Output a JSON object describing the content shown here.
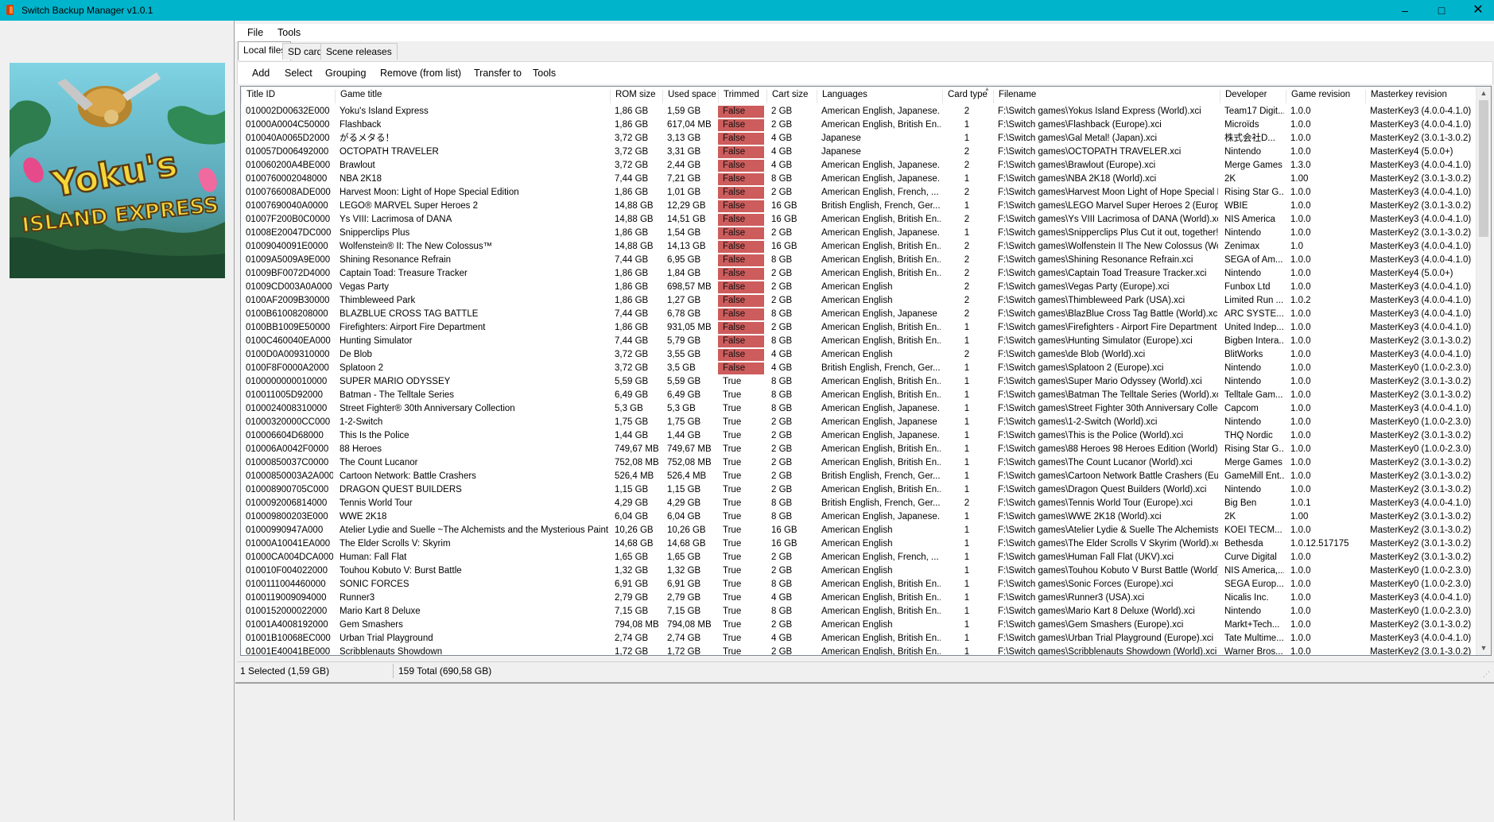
{
  "window": {
    "title": "Switch Backup Manager v1.0.1"
  },
  "menu": {
    "file": "File",
    "tools": "Tools"
  },
  "tabs": [
    "Local files",
    "SD card",
    "Scene releases"
  ],
  "toolbar": [
    "Add",
    "Select",
    "Grouping",
    "Remove (from list)",
    "Transfer to",
    "Tools"
  ],
  "cover": {
    "caption": "Yoku's Island Express"
  },
  "columns": [
    "Title ID",
    "Game title",
    "ROM size",
    "Used space",
    "Trimmed",
    "Cart size",
    "Languages",
    "Card type",
    "Filename",
    "Developer",
    "Game revision",
    "Masterkey revision"
  ],
  "rows": [
    [
      "010002D00632E000",
      "Yoku's Island Express",
      "1,86 GB",
      "1,59 GB",
      "False",
      "2 GB",
      "American English, Japanese...",
      "2",
      "F:\\Switch games\\Yokus Island Express (World).xci",
      "Team17 Digit...",
      "1.0.0",
      "MasterKey3 (4.0.0-4.1.0)"
    ],
    [
      "01000A0004C50000",
      "Flashback",
      "1,86 GB",
      "617,04 MB",
      "False",
      "2 GB",
      "American English, British En...",
      "1",
      "F:\\Switch games\\Flashback (Europe).xci",
      "Microïds",
      "1.0.0",
      "MasterKey3 (4.0.0-4.1.0)"
    ],
    [
      "010040A0065D2000",
      "がるメタる！",
      "3,72 GB",
      "3,13 GB",
      "False",
      "4 GB",
      "Japanese",
      "1",
      "F:\\Switch games\\Gal Metal! (Japan).xci",
      "株式会社D...",
      "1.0.0",
      "MasterKey2 (3.0.1-3.0.2)"
    ],
    [
      "010057D006492000",
      "OCTOPATH TRAVELER",
      "3,72 GB",
      "3,31 GB",
      "False",
      "4 GB",
      "Japanese",
      "2",
      "F:\\Switch games\\OCTOPATH TRAVELER.xci",
      "Nintendo",
      "1.0.0",
      "MasterKey4 (5.0.0+)"
    ],
    [
      "010060200A4BE000",
      "Brawlout",
      "3,72 GB",
      "2,44 GB",
      "False",
      "4 GB",
      "American English, Japanese...",
      "2",
      "F:\\Switch games\\Brawlout (Europe).xci",
      "Merge Games",
      "1.3.0",
      "MasterKey3 (4.0.0-4.1.0)"
    ],
    [
      "0100760002048000",
      "NBA 2K18",
      "7,44 GB",
      "7,21 GB",
      "False",
      "8 GB",
      "American English, Japanese...",
      "1",
      "F:\\Switch games\\NBA 2K18 (World).xci",
      "2K",
      "1.00",
      "MasterKey2 (3.0.1-3.0.2)"
    ],
    [
      "0100766008ADE000",
      "Harvest Moon: Light of Hope Special Edition",
      "1,86 GB",
      "1,01 GB",
      "False",
      "2 GB",
      "American English, French, ...",
      "2",
      "F:\\Switch games\\Harvest Moon Light of Hope Special E...",
      "Rising Star G...",
      "1.0.0",
      "MasterKey3 (4.0.0-4.1.0)"
    ],
    [
      "01007690040A0000",
      "LEGO® MARVEL Super Heroes 2",
      "14,88 GB",
      "12,29 GB",
      "False",
      "16 GB",
      "British English, French, Ger...",
      "1",
      "F:\\Switch games\\LEGO Marvel Super Heroes 2 (Europe...",
      "WBIE",
      "1.0.0",
      "MasterKey2 (3.0.1-3.0.2)"
    ],
    [
      "01007F200B0C0000",
      "Ys VIII: Lacrimosa of DANA",
      "14,88 GB",
      "14,51 GB",
      "False",
      "16 GB",
      "American English, British En...",
      "2",
      "F:\\Switch games\\Ys VIII Lacrimosa of DANA (World).xci",
      "NIS America",
      "1.0.0",
      "MasterKey3 (4.0.0-4.1.0)"
    ],
    [
      "01008E20047DC000",
      "Snipperclips Plus",
      "1,86 GB",
      "1,54 GB",
      "False",
      "2 GB",
      "American English, Japanese...",
      "1",
      "F:\\Switch games\\Snipperclips Plus Cut it out, together! (...",
      "Nintendo",
      "1.0.0",
      "MasterKey2 (3.0.1-3.0.2)"
    ],
    [
      "01009040091E0000",
      "Wolfenstein® II: The New Colossus™",
      "14,88 GB",
      "14,13 GB",
      "False",
      "16 GB",
      "American English, British En...",
      "2",
      "F:\\Switch games\\Wolfenstein II The New Colossus (Wo...",
      "Zenimax",
      "1.0",
      "MasterKey3 (4.0.0-4.1.0)"
    ],
    [
      "01009A5009A9E000",
      "Shining Resonance Refrain",
      "7,44 GB",
      "6,95 GB",
      "False",
      "8 GB",
      "American English, British En...",
      "2",
      "F:\\Switch games\\Shining Resonance Refrain.xci",
      "SEGA of Am...",
      "1.0.0",
      "MasterKey3 (4.0.0-4.1.0)"
    ],
    [
      "01009BF0072D4000",
      "Captain Toad: Treasure Tracker",
      "1,86 GB",
      "1,84 GB",
      "False",
      "2 GB",
      "American English, British En...",
      "2",
      "F:\\Switch games\\Captain Toad Treasure Tracker.xci",
      "Nintendo",
      "1.0.0",
      "MasterKey4 (5.0.0+)"
    ],
    [
      "01009CD003A0A000",
      "Vegas Party",
      "1,86 GB",
      "698,57 MB",
      "False",
      "2 GB",
      "American English",
      "2",
      "F:\\Switch games\\Vegas Party (Europe).xci",
      "Funbox Ltd",
      "1.0.0",
      "MasterKey3 (4.0.0-4.1.0)"
    ],
    [
      "0100AF2009B30000",
      "Thimbleweed Park",
      "1,86 GB",
      "1,27 GB",
      "False",
      "2 GB",
      "American English",
      "2",
      "F:\\Switch games\\Thimbleweed Park (USA).xci",
      "Limited Run ...",
      "1.0.2",
      "MasterKey3 (4.0.0-4.1.0)"
    ],
    [
      "0100B61008208000",
      "BLAZBLUE CROSS TAG BATTLE",
      "7,44 GB",
      "6,78 GB",
      "False",
      "8 GB",
      "American English, Japanese",
      "2",
      "F:\\Switch games\\BlazBlue Cross Tag Battle (World).xci",
      "ARC SYSTE...",
      "1.0.0",
      "MasterKey3 (4.0.0-4.1.0)"
    ],
    [
      "0100BB1009E50000",
      "Firefighters: Airport Fire Department",
      "1,86 GB",
      "931,05 MB",
      "False",
      "2 GB",
      "American English, British En...",
      "1",
      "F:\\Switch games\\Firefighters - Airport Fire Department (E...",
      "United Indep...",
      "1.0.0",
      "MasterKey3 (4.0.0-4.1.0)"
    ],
    [
      "0100C460040EA000",
      "Hunting Simulator",
      "7,44 GB",
      "5,79 GB",
      "False",
      "8 GB",
      "American English, British En...",
      "1",
      "F:\\Switch games\\Hunting Simulator (Europe).xci",
      "Bigben Intera...",
      "1.0.0",
      "MasterKey2 (3.0.1-3.0.2)"
    ],
    [
      "0100D0A009310000",
      "De Blob",
      "3,72 GB",
      "3,55 GB",
      "False",
      "4 GB",
      "American English",
      "2",
      "F:\\Switch games\\de Blob (World).xci",
      "BlitWorks",
      "1.0.0",
      "MasterKey3 (4.0.0-4.1.0)"
    ],
    [
      "0100F8F0000A2000",
      "Splatoon 2",
      "3,72 GB",
      "3,5 GB",
      "False",
      "4 GB",
      "British English, French, Ger...",
      "1",
      "F:\\Switch games\\Splatoon 2 (Europe).xci",
      "Nintendo",
      "1.0.0",
      "MasterKey0 (1.0.0-2.3.0)"
    ],
    [
      "0100000000010000",
      "SUPER MARIO ODYSSEY",
      "5,59 GB",
      "5,59 GB",
      "True",
      "8 GB",
      "American English, British En...",
      "1",
      "F:\\Switch games\\Super Mario Odyssey (World).xci",
      "Nintendo",
      "1.0.0",
      "MasterKey2 (3.0.1-3.0.2)"
    ],
    [
      "010011005D92000",
      "Batman - The Telltale Series",
      "6,49 GB",
      "6,49 GB",
      "True",
      "8 GB",
      "American English, British En...",
      "1",
      "F:\\Switch games\\Batman The Telltale Series (World).xci",
      "Telltale Gam...",
      "1.0.0",
      "MasterKey2 (3.0.1-3.0.2)"
    ],
    [
      "0100024008310000",
      "Street Fighter® 30th Anniversary Collection",
      "5,3 GB",
      "5,3 GB",
      "True",
      "8 GB",
      "American English, Japanese...",
      "1",
      "F:\\Switch games\\Street Fighter 30th Anniversary Collecti...",
      "Capcom",
      "1.0.0",
      "MasterKey3 (4.0.0-4.1.0)"
    ],
    [
      "01000320000CC000",
      "1-2-Switch",
      "1,75 GB",
      "1,75 GB",
      "True",
      "2 GB",
      "American English, Japanese",
      "1",
      "F:\\Switch games\\1-2-Switch (World).xci",
      "Nintendo",
      "1.0.0",
      "MasterKey0 (1.0.0-2.3.0)"
    ],
    [
      "010006604D68000",
      "This Is the Police",
      "1,44 GB",
      "1,44 GB",
      "True",
      "2 GB",
      "American English, Japanese...",
      "1",
      "F:\\Switch games\\This is the Police (World).xci",
      "THQ Nordic",
      "1.0.0",
      "MasterKey2 (3.0.1-3.0.2)"
    ],
    [
      "010006A0042F0000",
      "88 Heroes",
      "749,67 MB",
      "749,67 MB",
      "True",
      "2 GB",
      "American English, British En...",
      "1",
      "F:\\Switch games\\88 Heroes 98 Heroes Edition (World).xci",
      "Rising Star G...",
      "1.0.0",
      "MasterKey0 (1.0.0-2.3.0)"
    ],
    [
      "01000850037C0000",
      "The Count Lucanor",
      "752,08 MB",
      "752,08 MB",
      "True",
      "2 GB",
      "American English, British En...",
      "1",
      "F:\\Switch games\\The Count Lucanor (World).xci",
      "Merge Games",
      "1.0.0",
      "MasterKey2 (3.0.1-3.0.2)"
    ],
    [
      "01000850003A2A000",
      "Cartoon Network: Battle Crashers",
      "526,4 MB",
      "526,4 MB",
      "True",
      "2 GB",
      "British English, French, Ger...",
      "1",
      "F:\\Switch games\\Cartoon Network Battle Crashers (Euro...",
      "GameMill Ent...",
      "1.0.0",
      "MasterKey2 (3.0.1-3.0.2)"
    ],
    [
      "010008900705C000",
      "DRAGON QUEST BUILDERS",
      "1,15 GB",
      "1,15 GB",
      "True",
      "2 GB",
      "American English, British En...",
      "1",
      "F:\\Switch games\\Dragon Quest Builders (World).xci",
      "Nintendo",
      "1.0.0",
      "MasterKey2 (3.0.1-3.0.2)"
    ],
    [
      "0100092006814000",
      "Tennis World Tour",
      "4,29 GB",
      "4,29 GB",
      "True",
      "8 GB",
      "British English, French, Ger...",
      "2",
      "F:\\Switch games\\Tennis World Tour (Europe).xci",
      "Big Ben",
      "1.0.1",
      "MasterKey3 (4.0.0-4.1.0)"
    ],
    [
      "010009800203E000",
      "WWE 2K18",
      "6,04 GB",
      "6,04 GB",
      "True",
      "8 GB",
      "American English, Japanese...",
      "1",
      "F:\\Switch games\\WWE 2K18 (World).xci",
      "2K",
      "1.00",
      "MasterKey2 (3.0.1-3.0.2)"
    ],
    [
      "01000990947A000",
      "Atelier Lydie and Suelle ~The Alchemists and the Mysterious Paintin...",
      "10,26 GB",
      "10,26 GB",
      "True",
      "16 GB",
      "American English",
      "1",
      "F:\\Switch games\\Atelier Lydie & Suelle The Alchemists a...",
      "KOEI TECM...",
      "1.0.0",
      "MasterKey2 (3.0.1-3.0.2)"
    ],
    [
      "01000A10041EA000",
      "The Elder Scrolls V: Skyrim",
      "14,68 GB",
      "14,68 GB",
      "True",
      "16 GB",
      "American English",
      "1",
      "F:\\Switch games\\The Elder Scrolls V Skyrim (World).xci",
      "Bethesda",
      "1.0.12.517175",
      "MasterKey2 (3.0.1-3.0.2)"
    ],
    [
      "01000CA004DCA000",
      "Human: Fall Flat",
      "1,65 GB",
      "1,65 GB",
      "True",
      "2 GB",
      "American English, French, ...",
      "1",
      "F:\\Switch games\\Human Fall Flat (UKV).xci",
      "Curve Digital",
      "1.0.0",
      "MasterKey2 (3.0.1-3.0.2)"
    ],
    [
      "010010F004022000",
      "Touhou Kobuto V: Burst Battle",
      "1,32 GB",
      "1,32 GB",
      "True",
      "2 GB",
      "American English",
      "1",
      "F:\\Switch games\\Touhou Kobuto V Burst Battle (World)...",
      "NIS America,...",
      "1.0.0",
      "MasterKey0 (1.0.0-2.3.0)"
    ],
    [
      "0100111004460000",
      "SONIC FORCES",
      "6,91 GB",
      "6,91 GB",
      "True",
      "8 GB",
      "American English, British En...",
      "1",
      "F:\\Switch games\\Sonic Forces (Europe).xci",
      "SEGA Europ...",
      "1.0.0",
      "MasterKey0 (1.0.0-2.3.0)"
    ],
    [
      "0100119009094000",
      "Runner3",
      "2,79 GB",
      "2,79 GB",
      "True",
      "4 GB",
      "American English, British En...",
      "1",
      "F:\\Switch games\\Runner3 (USA).xci",
      "Nicalis Inc.",
      "1.0.0",
      "MasterKey3 (4.0.0-4.1.0)"
    ],
    [
      "0100152000022000",
      "Mario Kart 8 Deluxe",
      "7,15 GB",
      "7,15 GB",
      "True",
      "8 GB",
      "American English, British En...",
      "1",
      "F:\\Switch games\\Mario Kart 8 Deluxe (World).xci",
      "Nintendo",
      "1.0.0",
      "MasterKey0 (1.0.0-2.3.0)"
    ],
    [
      "01001A4008192000",
      "Gem Smashers",
      "794,08 MB",
      "794,08 MB",
      "True",
      "2 GB",
      "American English",
      "1",
      "F:\\Switch games\\Gem Smashers (Europe).xci",
      "Markt+Tech...",
      "1.0.0",
      "MasterKey2 (3.0.1-3.0.2)"
    ],
    [
      "01001B10068EC000",
      "Urban Trial Playground",
      "2,74 GB",
      "2,74 GB",
      "True",
      "4 GB",
      "American English, British En...",
      "1",
      "F:\\Switch games\\Urban Trial Playground (Europe).xci",
      "Tate Multime...",
      "1.0.0",
      "MasterKey3 (4.0.0-4.1.0)"
    ],
    [
      "01001E40041BE000",
      "Scribblenauts Showdown",
      "1,72 GB",
      "1,72 GB",
      "True",
      "2 GB",
      "American English, British En...",
      "1",
      "F:\\Switch games\\Scribblenauts Showdown (World).xci",
      "Warner Bros...",
      "1.0.0",
      "MasterKey2 (3.0.1-3.0.2)"
    ]
  ],
  "status": {
    "selected": "1 Selected (1,59 GB)",
    "total": "159 Total (690,58 GB)"
  },
  "colors": {
    "titlebar": "#00b4cc",
    "trimmed_false": "#cd5c5c"
  }
}
